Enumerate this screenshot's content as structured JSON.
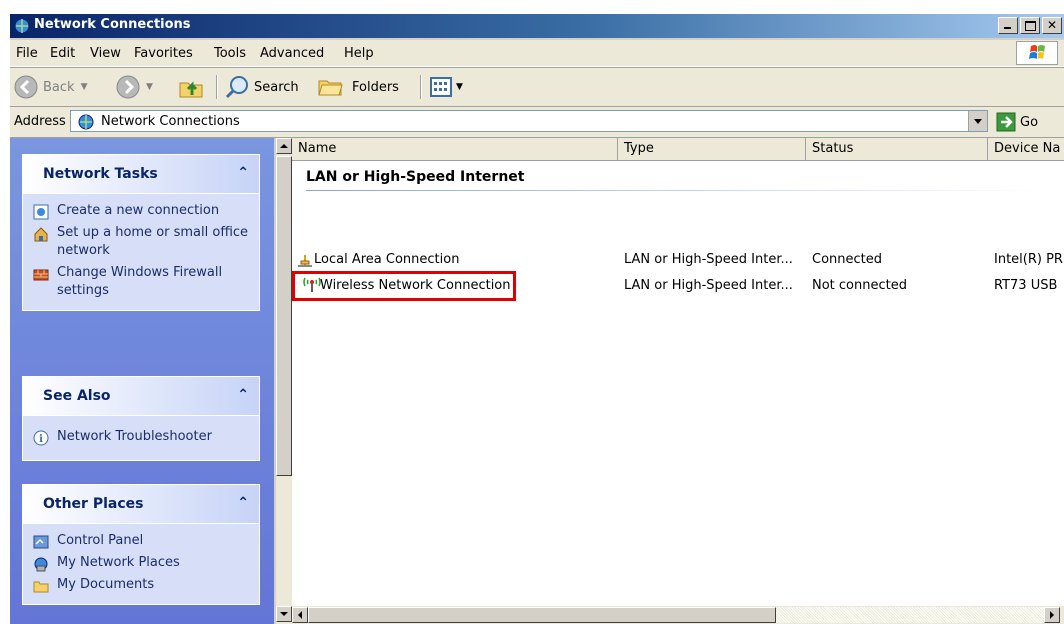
{
  "window": {
    "title": "Network Connections"
  },
  "menu": [
    "File",
    "Edit",
    "View",
    "Favorites",
    "Tools",
    "Advanced",
    "Help"
  ],
  "toolbar": {
    "back": "Back",
    "search": "Search",
    "folders": "Folders"
  },
  "address": {
    "label": "Address",
    "value": "Network Connections",
    "go": "Go"
  },
  "panels": {
    "network_tasks": {
      "title": "Network Tasks",
      "items": [
        "Create a new connection",
        "Set up a home or small office network",
        "Change Windows Firewall settings"
      ]
    },
    "see_also": {
      "title": "See Also",
      "items": [
        "Network Troubleshooter"
      ]
    },
    "other_places": {
      "title": "Other Places",
      "items": [
        "Control Panel",
        "My Network Places",
        "My Documents"
      ]
    }
  },
  "columns": [
    "Name",
    "Type",
    "Status",
    "Device Na"
  ],
  "group": "LAN or High-Speed Internet",
  "rows": [
    {
      "name": "Local Area Connection",
      "type": "LAN or High-Speed Inter...",
      "status": "Connected",
      "device": "Intel(R) PR"
    },
    {
      "name": "Wireless Network Connection",
      "type": "LAN or High-Speed Inter...",
      "status": "Not connected",
      "device": "RT73 USB"
    }
  ],
  "colors": {
    "highlight": "#e00000",
    "title_bar": "#0a246a",
    "task_pane": "#7a96df"
  }
}
